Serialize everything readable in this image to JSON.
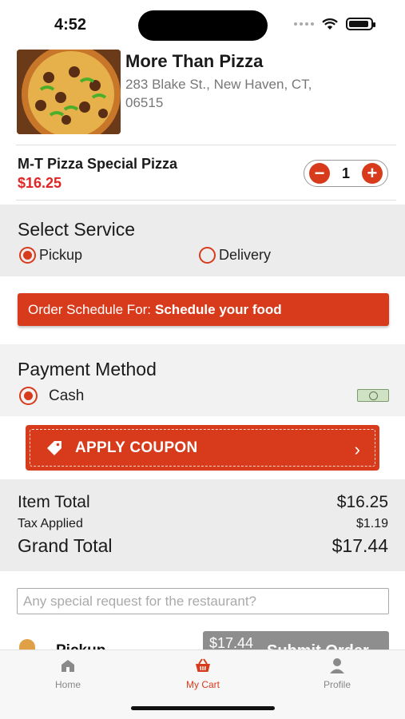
{
  "status_bar": {
    "time": "4:52"
  },
  "restaurant": {
    "name": "More Than Pizza",
    "address": "283 Blake St., New Haven, CT, 06515"
  },
  "cart_item": {
    "name": "M-T Pizza Special  Pizza",
    "price": "$16.25",
    "quantity": "1",
    "minus": "−",
    "plus": "+"
  },
  "service": {
    "title": "Select Service",
    "options": [
      {
        "label": "Pickup",
        "selected": true
      },
      {
        "label": "Delivery",
        "selected": false
      }
    ]
  },
  "schedule": {
    "prefix": "Order Schedule For:",
    "value": "Schedule your food"
  },
  "payment": {
    "title": "Payment Method",
    "method": "Cash",
    "icon": "cash-icon"
  },
  "coupon": {
    "label": "APPLY COUPON",
    "chevron": "›"
  },
  "totals": {
    "item_total_label": "Item Total",
    "item_total": "$16.25",
    "tax_label": "Tax Applied",
    "tax": "$1.19",
    "grand_total_label": "Grand Total",
    "grand_total": "$17.44"
  },
  "special_request": {
    "placeholder": "Any special request for the restaurant?"
  },
  "footer_action": {
    "mode": "Pickup",
    "price": "$17.44",
    "submit_label": "Submit Order"
  },
  "tabs": [
    {
      "label": "Home",
      "icon": "home-icon",
      "active": false
    },
    {
      "label": "My Cart",
      "icon": "basket-icon",
      "active": true
    },
    {
      "label": "Profile",
      "icon": "person-icon",
      "active": false
    }
  ],
  "colors": {
    "accent": "#d83b1c",
    "price_red": "#e12525",
    "section_gray": "#ececec"
  }
}
